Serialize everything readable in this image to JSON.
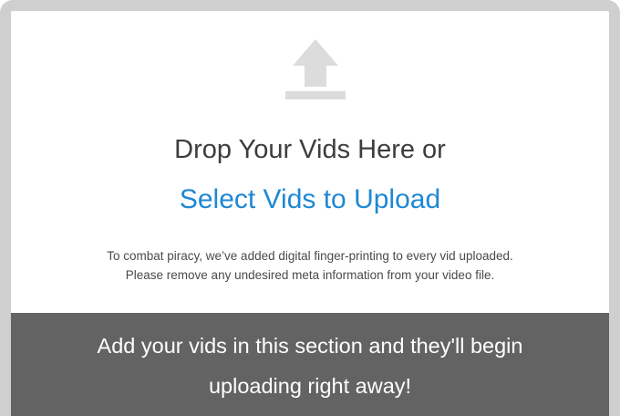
{
  "dropzone": {
    "icon": "upload-arrow-icon",
    "drop_text": "Drop Your Vids Here or",
    "select_link": "Select Vids to Upload",
    "note_line1": "To combat piracy, we’ve added digital finger-printing to every vid uploaded.",
    "note_line2": "Please remove any undesired meta information from your video file."
  },
  "banner": {
    "line1": "Add your vids in this section and they'll begin",
    "line2": "uploading right away!"
  },
  "colors": {
    "border": "#cfcfcf",
    "icon": "#dcdcdc",
    "link": "#1e88d4",
    "banner_bg": "#636363"
  }
}
